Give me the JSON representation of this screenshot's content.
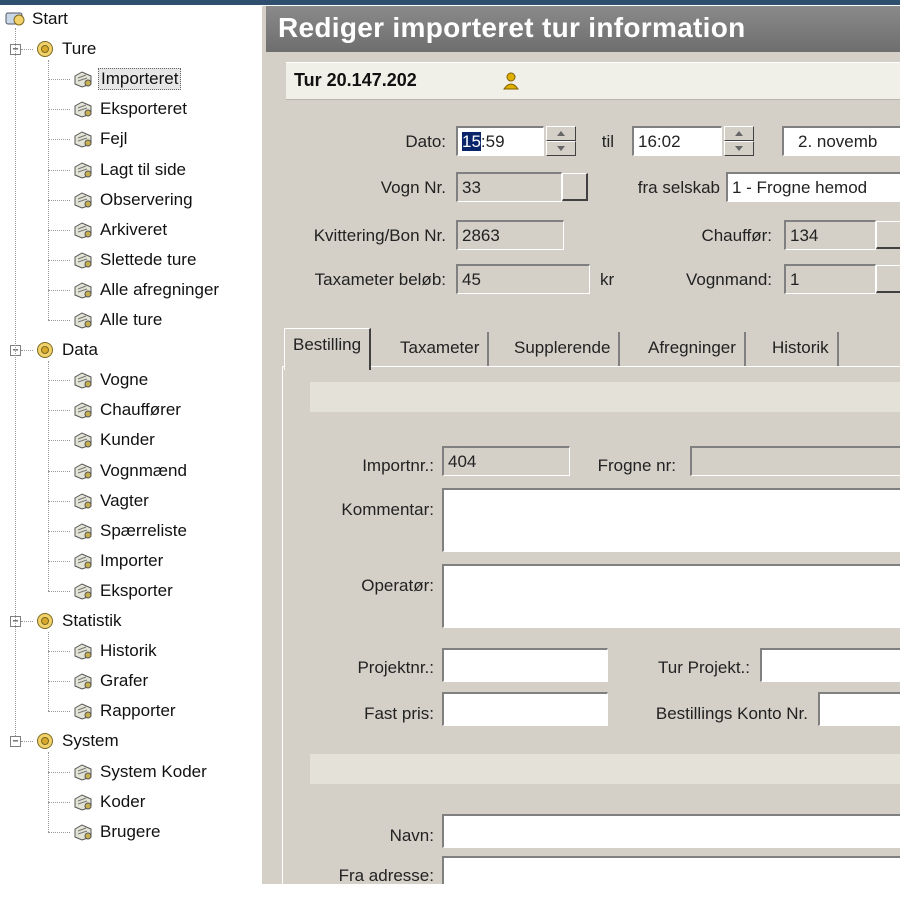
{
  "tree": {
    "root": {
      "label": "Start",
      "icon": "start-icon"
    },
    "groups": [
      {
        "label": "Ture",
        "icon": "folder-icon",
        "items": [
          {
            "label": "Importeret",
            "icon": "import-icon",
            "selected": true
          },
          {
            "label": "Eksporteret",
            "icon": "export-icon"
          },
          {
            "label": "Fejl",
            "icon": "error-icon"
          },
          {
            "label": "Lagt til side",
            "icon": "set-aside-icon"
          },
          {
            "label": "Observering",
            "icon": "observe-icon"
          },
          {
            "label": "Arkiveret",
            "icon": "archive-icon"
          },
          {
            "label": "Slettede ture",
            "icon": "trash-icon"
          },
          {
            "label": "Alle afregninger",
            "icon": "settlement-icon"
          },
          {
            "label": "Alle ture",
            "icon": "all-trips-icon"
          }
        ]
      },
      {
        "label": "Data",
        "icon": "folder-icon",
        "items": [
          {
            "label": "Vogne",
            "icon": "car-icon"
          },
          {
            "label": "Chauffører",
            "icon": "driver-icon"
          },
          {
            "label": "Kunder",
            "icon": "customer-icon"
          },
          {
            "label": "Vognmænd",
            "icon": "owner-icon"
          },
          {
            "label": "Vagter",
            "icon": "shift-icon"
          },
          {
            "label": "Spærreliste",
            "icon": "blocklist-icon"
          },
          {
            "label": "Importer",
            "icon": "import-data-icon"
          },
          {
            "label": "Eksporter",
            "icon": "export-data-icon"
          }
        ]
      },
      {
        "label": "Statistik",
        "icon": "folder-icon",
        "items": [
          {
            "label": "Historik",
            "icon": "history-icon"
          },
          {
            "label": "Grafer",
            "icon": "graph-icon"
          },
          {
            "label": "Rapporter",
            "icon": "report-icon"
          }
        ]
      },
      {
        "label": "System",
        "icon": "folder-icon",
        "items": [
          {
            "label": "System Koder",
            "icon": "system-codes-icon"
          },
          {
            "label": "Koder",
            "icon": "codes-icon"
          },
          {
            "label": "Brugere",
            "icon": "users-icon"
          }
        ]
      }
    ]
  },
  "panel": {
    "title": "Rediger importeret tur information",
    "tur_title": "Tur 20.147.202",
    "fields": {
      "dato_label": "Dato:",
      "time_from_sel": "15",
      "time_from_rest": ":59",
      "til_label": "til",
      "time_to": "16:02",
      "date": "2. novemb",
      "vogn_label": "Vogn Nr.",
      "vogn_value": "33",
      "selskab_label": "fra selskab",
      "selskab_value": "1 - Frogne hemod",
      "kvittering_label": "Kvittering/Bon Nr.",
      "kvittering_value": "2863",
      "chauffor_label": "Chauffør:",
      "chauffor_value": "134",
      "taxameter_label": "Taxameter beløb:",
      "taxameter_value": "45",
      "kr_label": "kr",
      "vognmand_label": "Vognmand:",
      "vognmand_value": "1"
    },
    "tabs": [
      "Bestilling",
      "Taxameter",
      "Supplerende",
      "Afregninger",
      "Historik"
    ],
    "bestilling": {
      "importnr_label": "Importnr.:",
      "importnr_value": "404",
      "frogne_label": "Frogne nr:",
      "frogne_value": "",
      "kommentar_label": "Kommentar:",
      "operator_label": "Operatør:",
      "projektnr_label": "Projektnr.:",
      "tur_projekt_label": "Tur Projekt.:",
      "fast_pris_label": "Fast pris:",
      "bestillings_konto_label": "Bestillings Konto Nr.",
      "navn_label": "Navn:",
      "fra_adresse_label": "Fra adresse:"
    }
  }
}
